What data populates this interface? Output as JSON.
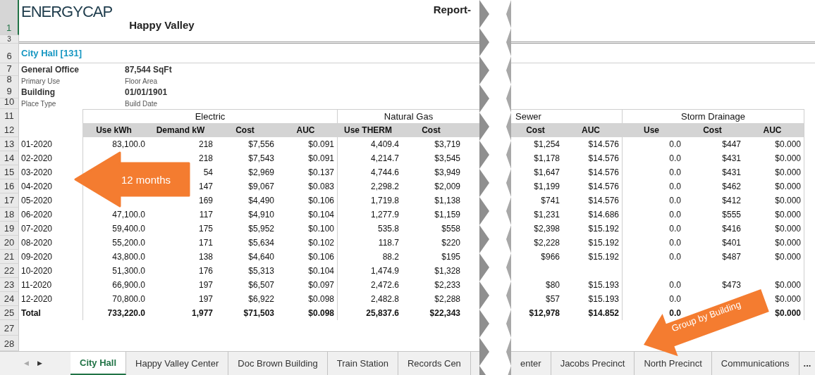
{
  "header": {
    "logo": "ENERGYCAP",
    "title": "Happy Valley",
    "report": "Report-"
  },
  "row_numbers": [
    {
      "label": "1",
      "selected": true
    },
    {
      "label": "3",
      "selected": false
    },
    {
      "label": "6",
      "selected": false
    },
    {
      "label": "7",
      "selected": false
    },
    {
      "label": "8",
      "selected": false
    },
    {
      "label": "9",
      "selected": false
    },
    {
      "label": "10",
      "selected": false
    },
    {
      "label": "11",
      "selected": false
    },
    {
      "label": "12",
      "selected": false
    },
    {
      "label": "13",
      "selected": false
    },
    {
      "label": "14",
      "selected": false
    },
    {
      "label": "15",
      "selected": false
    },
    {
      "label": "16",
      "selected": false
    },
    {
      "label": "17",
      "selected": false
    },
    {
      "label": "18",
      "selected": false
    },
    {
      "label": "19",
      "selected": false
    },
    {
      "label": "20",
      "selected": false
    },
    {
      "label": "21",
      "selected": false
    },
    {
      "label": "22",
      "selected": false
    },
    {
      "label": "23",
      "selected": false
    },
    {
      "label": "24",
      "selected": false
    },
    {
      "label": "25",
      "selected": false
    },
    {
      "label": "27",
      "selected": false
    },
    {
      "label": "28",
      "selected": false
    }
  ],
  "building": {
    "name": "City Hall [131]",
    "details": [
      {
        "value": "General Office",
        "caption": "Primary Use"
      },
      {
        "value": "87,544 SqFt",
        "caption": "Floor Area"
      },
      {
        "value": "Building",
        "caption": "Place Type"
      },
      {
        "value": "01/01/1901",
        "caption": "Build Date"
      }
    ]
  },
  "left_groups": [
    {
      "name": "Electric",
      "columns": [
        "Use kWh",
        "Demand kW",
        "Cost",
        "AUC"
      ]
    },
    {
      "name": "Natural Gas",
      "columns": [
        "Use THERM",
        "Cost"
      ]
    }
  ],
  "right_groups": [
    {
      "name": "Sewer",
      "columns": [
        "Cost",
        "AUC"
      ]
    },
    {
      "name": "Storm Drainage",
      "columns": [
        "Use",
        "Cost",
        "AUC"
      ]
    }
  ],
  "rows": [
    {
      "kind": "month",
      "period": "01-2020",
      "left": {
        "electric_use": "83,100.0",
        "electric_demand": "218",
        "electric_cost": "$7,556",
        "electric_auc": "$0.091",
        "gas_use": "4,409.4",
        "gas_cost": "$3,719"
      },
      "right": {
        "sewer_cost": "$1,254",
        "sewer_auc": "$14.576",
        "storm_use": "0.0",
        "storm_cost": "$447",
        "storm_auc": "$0.000"
      }
    },
    {
      "kind": "month",
      "period": "02-2020",
      "left": {
        "electric_demand": "218",
        "electric_cost": "$7,543",
        "electric_auc": "$0.091",
        "gas_use": "4,214.7",
        "gas_cost": "$3,545"
      },
      "right": {
        "sewer_cost": "$1,178",
        "sewer_auc": "$14.576",
        "storm_use": "0.0",
        "storm_cost": "$431",
        "storm_auc": "$0.000"
      }
    },
    {
      "kind": "month",
      "period": "03-2020",
      "left": {
        "electric_demand": "54",
        "electric_cost": "$2,969",
        "electric_auc": "$0.137",
        "gas_use": "4,744.6",
        "gas_cost": "$3,949"
      },
      "right": {
        "sewer_cost": "$1,647",
        "sewer_auc": "$14.576",
        "storm_use": "0.0",
        "storm_cost": "$431",
        "storm_auc": "$0.000"
      }
    },
    {
      "kind": "month",
      "period": "04-2020",
      "left": {
        "electric_demand": "147",
        "electric_cost": "$9,067",
        "electric_auc": "$0.083",
        "gas_use": "2,298.2",
        "gas_cost": "$2,009"
      },
      "right": {
        "sewer_cost": "$1,199",
        "sewer_auc": "$14.576",
        "storm_use": "0.0",
        "storm_cost": "$462",
        "storm_auc": "$0.000"
      }
    },
    {
      "kind": "month",
      "period": "05-2020",
      "left": {
        "electric_demand": "169",
        "electric_cost": "$4,490",
        "electric_auc": "$0.106",
        "gas_use": "1,719.8",
        "gas_cost": "$1,138"
      },
      "right": {
        "sewer_cost": "$741",
        "sewer_auc": "$14.576",
        "storm_use": "0.0",
        "storm_cost": "$412",
        "storm_auc": "$0.000"
      }
    },
    {
      "kind": "month",
      "period": "06-2020",
      "left": {
        "electric_use": "47,100.0",
        "electric_demand": "117",
        "electric_cost": "$4,910",
        "electric_auc": "$0.104",
        "gas_use": "1,277.9",
        "gas_cost": "$1,159"
      },
      "right": {
        "sewer_cost": "$1,231",
        "sewer_auc": "$14.686",
        "storm_use": "0.0",
        "storm_cost": "$555",
        "storm_auc": "$0.000"
      }
    },
    {
      "kind": "month",
      "period": "07-2020",
      "left": {
        "electric_use": "59,400.0",
        "electric_demand": "175",
        "electric_cost": "$5,952",
        "electric_auc": "$0.100",
        "gas_use": "535.8",
        "gas_cost": "$558"
      },
      "right": {
        "sewer_cost": "$2,398",
        "sewer_auc": "$15.192",
        "storm_use": "0.0",
        "storm_cost": "$416",
        "storm_auc": "$0.000"
      }
    },
    {
      "kind": "month",
      "period": "08-2020",
      "left": {
        "electric_use": "55,200.0",
        "electric_demand": "171",
        "electric_cost": "$5,634",
        "electric_auc": "$0.102",
        "gas_use": "118.7",
        "gas_cost": "$220"
      },
      "right": {
        "sewer_cost": "$2,228",
        "sewer_auc": "$15.192",
        "storm_use": "0.0",
        "storm_cost": "$401",
        "storm_auc": "$0.000"
      }
    },
    {
      "kind": "month",
      "period": "09-2020",
      "left": {
        "electric_use": "43,800.0",
        "electric_demand": "138",
        "electric_cost": "$4,640",
        "electric_auc": "$0.106",
        "gas_use": "88.2",
        "gas_cost": "$195"
      },
      "right": {
        "sewer_cost": "$966",
        "sewer_auc": "$15.192",
        "storm_use": "0.0",
        "storm_cost": "$487",
        "storm_auc": "$0.000"
      }
    },
    {
      "kind": "month",
      "period": "10-2020",
      "left": {
        "electric_use": "51,300.0",
        "electric_demand": "176",
        "electric_cost": "$5,313",
        "electric_auc": "$0.104",
        "gas_use": "1,474.9",
        "gas_cost": "$1,328"
      }
    },
    {
      "kind": "month",
      "period": "11-2020",
      "left": {
        "electric_use": "66,900.0",
        "electric_demand": "197",
        "electric_cost": "$6,507",
        "electric_auc": "$0.097",
        "gas_use": "2,472.6",
        "gas_cost": "$2,233"
      },
      "right": {
        "sewer_cost": "$80",
        "sewer_auc": "$15.193",
        "storm_use": "0.0",
        "storm_cost": "$473",
        "storm_auc": "$0.000"
      }
    },
    {
      "kind": "month",
      "period": "12-2020",
      "left": {
        "electric_use": "70,800.0",
        "electric_demand": "197",
        "electric_cost": "$6,922",
        "electric_auc": "$0.098",
        "gas_use": "2,482.8",
        "gas_cost": "$2,288"
      },
      "right": {
        "sewer_cost": "$57",
        "sewer_auc": "$15.193",
        "storm_use": "0.0",
        "storm_auc": "$0.000"
      }
    },
    {
      "kind": "total",
      "period": "Total",
      "left": {
        "electric_use": "733,220.0",
        "electric_demand": "1,977",
        "electric_cost": "$71,503",
        "electric_auc": "$0.098",
        "gas_use": "25,837.6",
        "gas_cost": "$22,343"
      },
      "right": {
        "sewer_cost": "$12,978",
        "sewer_auc": "$14.852",
        "storm_use": "0.0",
        "storm_auc": "$0.000"
      }
    }
  ],
  "annotations": [
    {
      "text": "12 months"
    },
    {
      "text": "Group by Building"
    }
  ],
  "tab_nav": [
    {
      "glyph": "◀",
      "disabled": true
    },
    {
      "glyph": "▶",
      "disabled": false
    }
  ],
  "tabs_left": [
    {
      "label": "City Hall",
      "selected": true
    },
    {
      "label": "Happy Valley Center",
      "selected": false
    },
    {
      "label": "Doc Brown Building",
      "selected": false
    },
    {
      "label": "Train Station",
      "selected": false
    },
    {
      "label": "Records Cen",
      "selected": false
    }
  ],
  "tabs_right": [
    {
      "label": "enter",
      "selected": false
    },
    {
      "label": "Jacobs Precinct",
      "selected": false
    },
    {
      "label": "North Precinct",
      "selected": false
    },
    {
      "label": "Communications",
      "selected": false
    }
  ],
  "more_tabs": "..."
}
